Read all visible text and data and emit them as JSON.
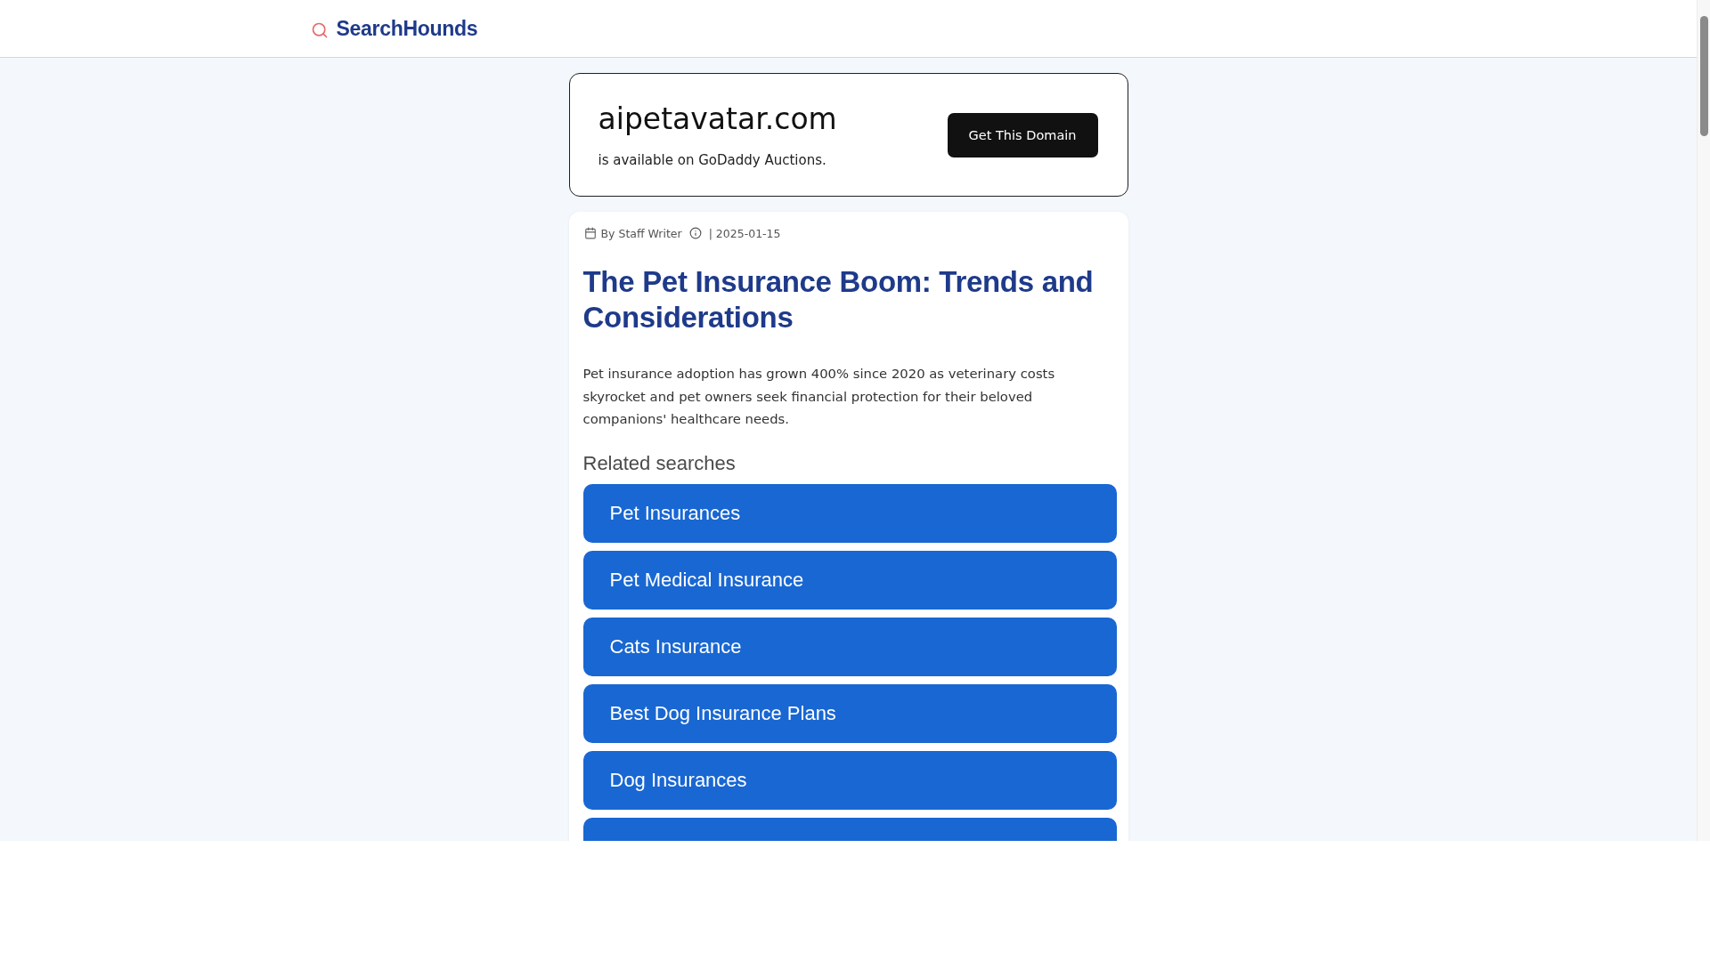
{
  "header": {
    "brand": "SearchHounds"
  },
  "domain_offer": {
    "domain": "aipetavatar.com",
    "note": "is available on GoDaddy Auctions.",
    "button": "Get This Domain"
  },
  "article": {
    "byline": "By Staff Writer",
    "date": "| 2025-01-15",
    "title": "The Pet Insurance Boom: Trends and Considerations",
    "summary": "Pet insurance adoption has grown 400% since 2020 as veterinary costs skyrocket and pet owners seek financial protection for their beloved companions' healthcare needs.",
    "related": {
      "heading": "Related searches",
      "items": [
        {
          "kind": "link",
          "label": "Pet Insurances"
        },
        {
          "kind": "link",
          "label": "Pet Medical Insurance"
        },
        {
          "kind": "link",
          "label": "Cats Insurance"
        },
        {
          "kind": "link",
          "label": "Best Dog Insurance Plans"
        },
        {
          "kind": "link",
          "label": "Dog Insurances"
        },
        {
          "kind": "clipped"
        }
      ]
    }
  }
}
